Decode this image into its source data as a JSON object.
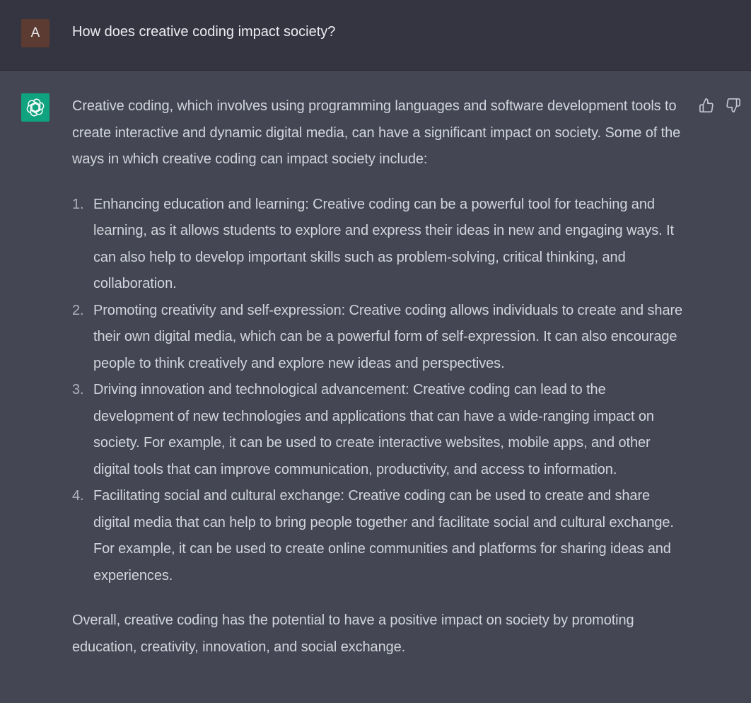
{
  "user_message": {
    "avatar_initial": "A",
    "text": "How does creative coding impact society?"
  },
  "assistant_message": {
    "intro": "Creative coding, which involves using programming languages and software development tools to create interactive and dynamic digital media, can have a significant impact on society. Some of the ways in which creative coding can impact society include:",
    "items": [
      {
        "text": "Enhancing education and learning: Creative coding can be a powerful tool for teaching and learning, as it allows students to explore and express their ideas in new and engaging ways. It can also help to develop important skills such as problem-solving, critical thinking, and collaboration."
      },
      {
        "text": "Promoting creativity and self-expression: Creative coding allows individuals to create and share their own digital media, which can be a powerful form of self-expression. It can also encourage people to think creatively and explore new ideas and perspectives."
      },
      {
        "text": "Driving innovation and technological advancement: Creative coding can lead to the development of new technologies and applications that can have a wide-ranging impact on society. For example, it can be used to create interactive websites, mobile apps, and other digital tools that can improve communication, productivity, and access to information."
      },
      {
        "text": "Facilitating social and cultural exchange: Creative coding can be used to create and share digital media that can help to bring people together and facilitate social and cultural exchange. For example, it can be used to create online communities and platforms for sharing ideas and experiences."
      }
    ],
    "conclusion": "Overall, creative coding has the potential to have a positive impact on society by promoting education, creativity, innovation, and social exchange."
  },
  "icons": {
    "assistant_avatar": "openai-logo-icon",
    "feedback_up": "thumbs-up-icon",
    "feedback_down": "thumbs-down-icon"
  },
  "colors": {
    "user_row_bg": "#343541",
    "assistant_row_bg": "#444654",
    "user_avatar_bg": "#5c3b32",
    "assistant_avatar_bg": "#10a37f",
    "text": "#d1d5db"
  }
}
